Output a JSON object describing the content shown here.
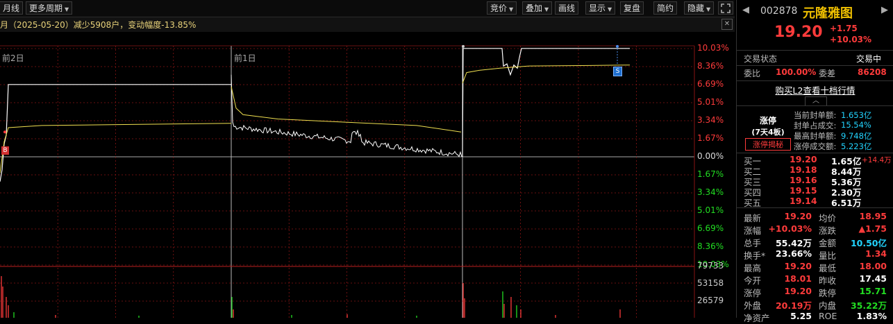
{
  "toolbar": {
    "left_tab": "月线",
    "more_period": "更多周期",
    "buttons": [
      "竞价",
      "叠加",
      "画线",
      "显示",
      "复盘",
      "简约",
      "隐藏"
    ]
  },
  "info_bar": {
    "text": "月（2025-05-20）减少5908户，变动幅度-13.85%"
  },
  "chart": {
    "day_labels": [
      "前2日",
      "前1日"
    ],
    "pct_ticks_up": [
      "10.03%",
      "8.36%",
      "6.69%",
      "5.01%",
      "3.34%",
      "1.67%"
    ],
    "pct_zero": "0.00%",
    "pct_ticks_down": [
      "1.67%",
      "3.34%",
      "5.01%",
      "6.69%",
      "8.36%",
      "10.03%"
    ],
    "vol_ticks": [
      "79733",
      "53158",
      "26579"
    ],
    "markers": {
      "buy": "B",
      "sell": "S"
    },
    "colors": {
      "up": "#ff3b3b",
      "down": "#22dd22",
      "price": "#ffffff",
      "avg": "#f0e050",
      "grid": "#8a1414"
    }
  },
  "stock": {
    "code": "002878",
    "name": "元隆雅图",
    "price": "19.20",
    "change": "+1.75",
    "change_pct": "+10.03%"
  },
  "status": {
    "label": "交易状态",
    "value": "交易中",
    "weibi_label": "委比",
    "weibi_value": "100.00%",
    "weicha_label": "委差",
    "weicha_value": "86208"
  },
  "l2_link": "购买L2查看十档行情",
  "limit": {
    "title": "涨停",
    "sub": "(7天4板)",
    "reveal_button": "涨停揭秘",
    "items": [
      {
        "label": "当前封单额:",
        "value": "1.653亿"
      },
      {
        "label": "封单占成交:",
        "value": "15.54%"
      },
      {
        "label": "最高封单额:",
        "value": "9.748亿"
      },
      {
        "label": "涨停成交额:",
        "value": "5.223亿"
      }
    ]
  },
  "bids": [
    {
      "label": "买一",
      "price": "19.20",
      "vol": "1.65亿",
      "delta": "+14.4万"
    },
    {
      "label": "买二",
      "price": "19.18",
      "vol": "8.44万",
      "delta": ""
    },
    {
      "label": "买三",
      "price": "19.16",
      "vol": "5.36万",
      "delta": ""
    },
    {
      "label": "买四",
      "price": "19.15",
      "vol": "2.30万",
      "delta": ""
    },
    {
      "label": "买五",
      "price": "19.14",
      "vol": "6.51万",
      "delta": ""
    }
  ],
  "quote": [
    {
      "k1": "最新",
      "v1": "19.20",
      "c1": "red",
      "k2": "均价",
      "v2": "18.95",
      "c2": "red"
    },
    {
      "k1": "涨幅",
      "v1": "+10.03%",
      "c1": "red",
      "k2": "涨跌",
      "v2": "▲1.75",
      "c2": "red"
    },
    {
      "k1": "总手",
      "v1": "55.42万",
      "c1": "white",
      "k2": "金额",
      "v2": "10.50亿",
      "c2": "cyan"
    },
    {
      "k1": "换手*",
      "v1": "23.66%",
      "c1": "white",
      "k2": "量比",
      "v2": "1.34",
      "c2": "red"
    },
    {
      "k1": "最高",
      "v1": "19.20",
      "c1": "red",
      "k2": "最低",
      "v2": "18.00",
      "c2": "red"
    },
    {
      "k1": "今开",
      "v1": "18.01",
      "c1": "red",
      "k2": "昨收",
      "v2": "17.45",
      "c2": "white"
    },
    {
      "k1": "涨停",
      "v1": "19.20",
      "c1": "red",
      "k2": "跌停",
      "v2": "15.71",
      "c2": "green"
    },
    {
      "k1": "外盘",
      "v1": "20.19万",
      "c1": "red",
      "k2": "内盘",
      "v2": "35.22万",
      "c2": "green"
    },
    {
      "k1": "净资产",
      "v1": "5.25",
      "c1": "white",
      "k2": "ROE",
      "v2": "1.83%",
      "c2": "white"
    }
  ]
}
